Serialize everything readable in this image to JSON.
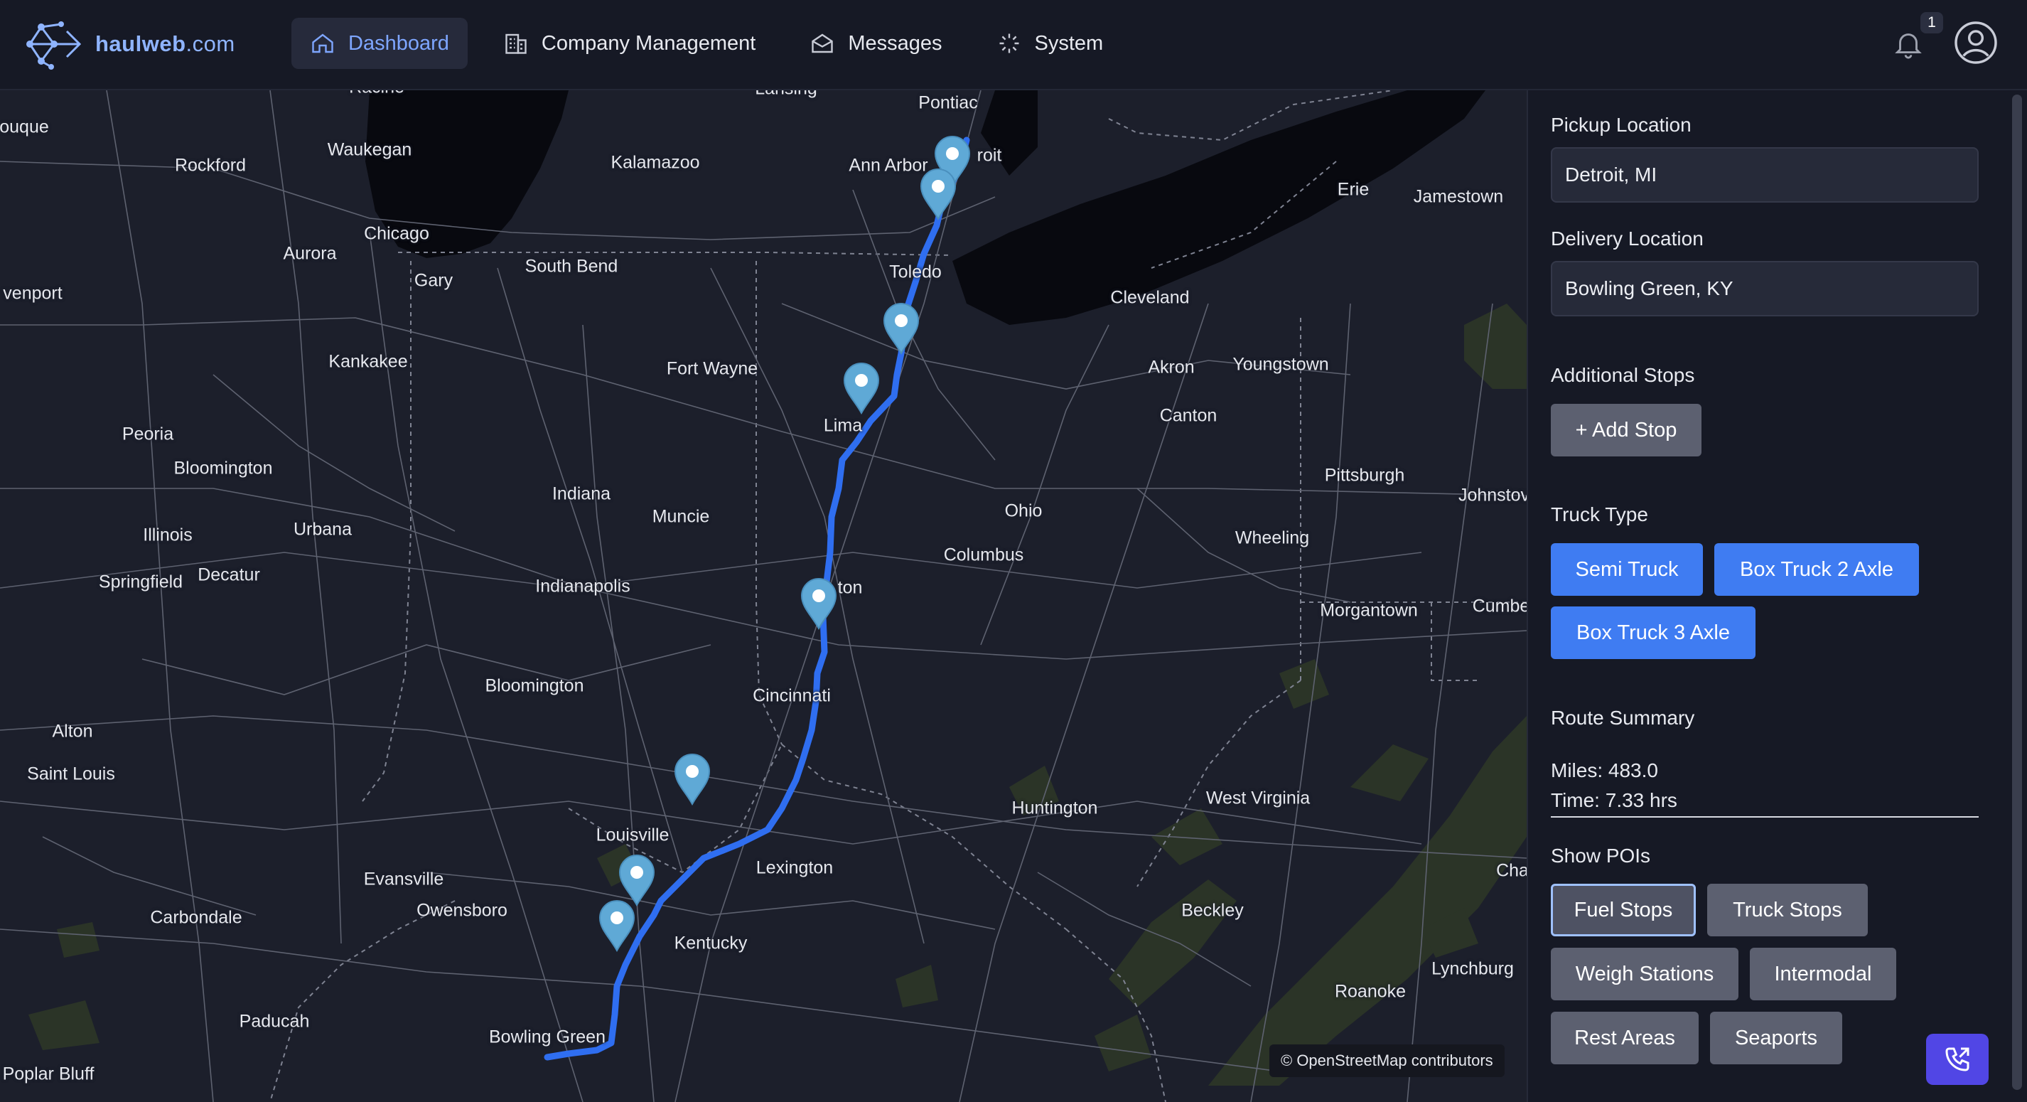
{
  "brand": {
    "name": "haulweb",
    "tld": ".com",
    "logo_icon": "network-arrow-logo-icon"
  },
  "nav": {
    "items": [
      {
        "label": "Dashboard",
        "icon": "home-icon",
        "active": true
      },
      {
        "label": "Company Management",
        "icon": "building-icon",
        "active": false
      },
      {
        "label": "Messages",
        "icon": "envelope-icon",
        "active": false
      },
      {
        "label": "System",
        "icon": "loader-icon",
        "active": false
      }
    ],
    "notifications_count": "1"
  },
  "map": {
    "attribution": "© OpenStreetMap contributors",
    "cities": [
      "Racine",
      "Lansing",
      "Pontiac",
      "ouque",
      "Waukegan",
      "Rockford",
      "Kalamazoo",
      "Ann Arbor",
      "roit",
      "Erie",
      "Jamestown",
      "Chicago",
      "Aurora",
      "Gary",
      "South Bend",
      "venport",
      "Toledo",
      "Cleveland",
      "Kankakee",
      "Fort Wayne",
      "Akron",
      "Youngstown",
      "Canton",
      "Peoria",
      "Lima",
      "Bloomington",
      "Pittsburgh",
      "Johnstov",
      "Indiana",
      "Muncie",
      "Ohio",
      "Illinois",
      "Urbana",
      "Wheeling",
      "Columbus",
      "Springfield",
      "Decatur",
      "Indianapolis",
      "ton",
      "Morgantown",
      "Cumbe",
      "Bloomington",
      "Cincinnati",
      "Alton",
      "Saint Louis",
      "West Virginia",
      "Huntington",
      "Louisville",
      "Lexington",
      "Cha",
      "Evansville",
      "Carbondale",
      "Owensboro",
      "Beckley",
      "Kentucky",
      "Lynchburg",
      "Roanoke",
      "Paducah",
      "Bowling Green",
      "Poplar Bluff"
    ],
    "route_color": "#2f6ef0",
    "marker_color": "#5fa9d6",
    "marker_count": 9
  },
  "panel": {
    "pickup": {
      "label": "Pickup Location",
      "value": "Detroit, MI"
    },
    "delivery": {
      "label": "Delivery Location",
      "value": "Bowling Green, KY"
    },
    "stops": {
      "label": "Additional Stops",
      "button": "+ Add Stop"
    },
    "truck": {
      "label": "Truck Type",
      "options": [
        "Semi Truck",
        "Box Truck 2 Axle",
        "Box Truck 3 Axle"
      ]
    },
    "summary": {
      "label": "Route Summary",
      "miles": "Miles: 483.0",
      "time": "Time: 7.33 hrs"
    },
    "pois": {
      "label": "Show POIs",
      "options": [
        "Fuel Stops",
        "Truck Stops",
        "Weigh Stations",
        "Intermodal",
        "Rest Areas",
        "Seaports"
      ],
      "selected": "Fuel Stops"
    }
  },
  "call_icon": "phone-call-icon",
  "colors": {
    "accent": "#3f7cf2",
    "nav_active": "#7ea6ff",
    "background": "#161925",
    "button_grey": "#5c6070"
  }
}
